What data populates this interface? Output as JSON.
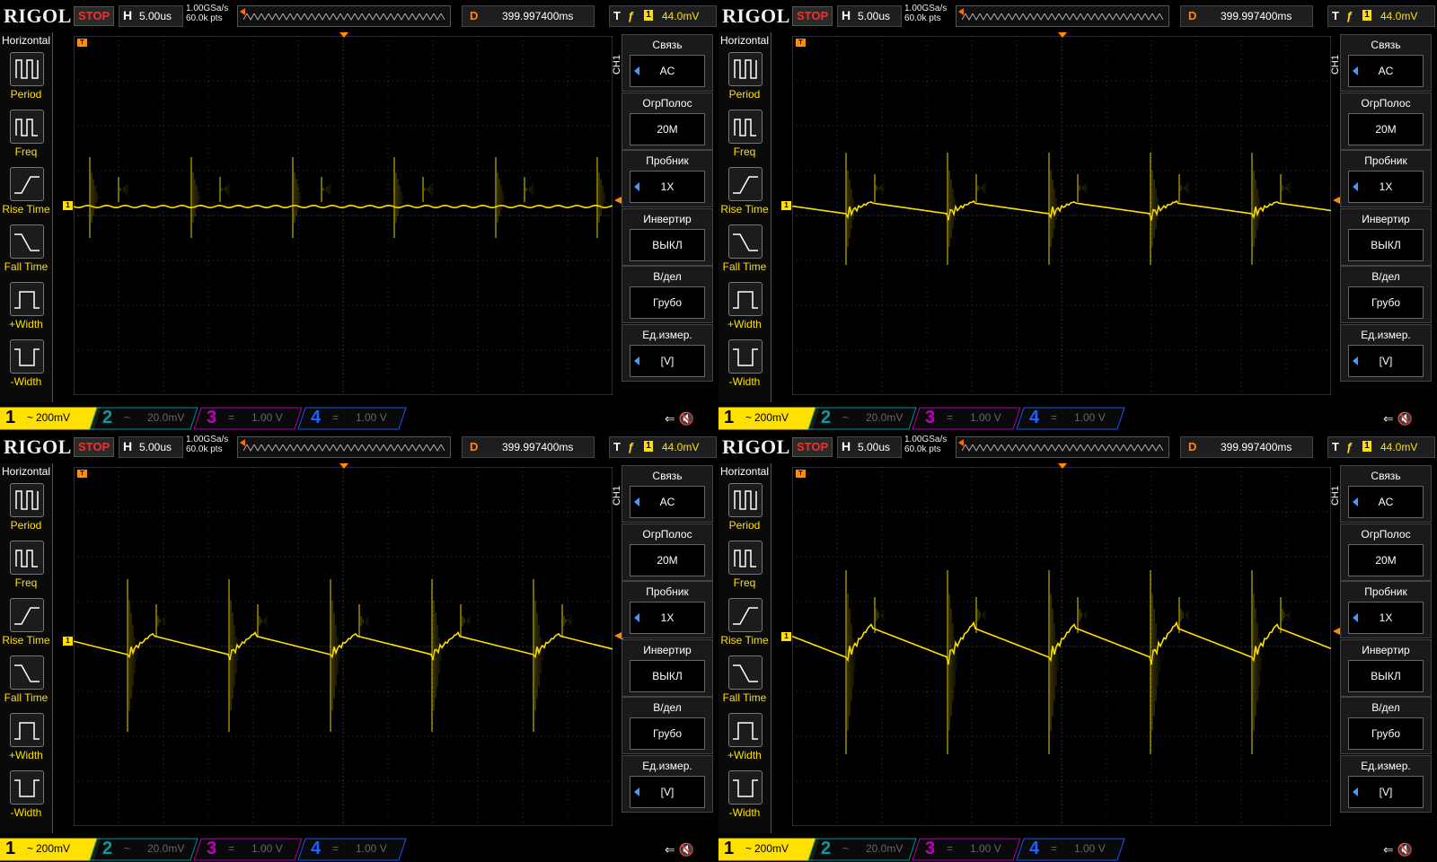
{
  "brand": "RIGOL",
  "run_state": "STOP",
  "horizontal": {
    "key": "H",
    "timebase": "5.00us"
  },
  "sample": {
    "rate": "1.00GSa/s",
    "depth": "60.0k pts"
  },
  "delay": {
    "key": "D",
    "value": "399.997400ms"
  },
  "trigger": {
    "key": "T",
    "edge": "ƒ",
    "source": "1",
    "level": "44.0mV"
  },
  "left_menu": {
    "title": "Horizontal",
    "items": [
      "Period",
      "Freq",
      "Rise Time",
      "Fall Time",
      "+Width",
      "-Width"
    ]
  },
  "right_menu": {
    "channel_label": "CH1",
    "items": [
      {
        "title": "Связь",
        "value": "AC",
        "arrow": true
      },
      {
        "title": "ОгрПолос",
        "value": "20M",
        "arrow": false
      },
      {
        "title": "Пробник",
        "value": "1X",
        "arrow": true
      },
      {
        "title": "Инвертир",
        "value": "ВЫКЛ",
        "arrow": false
      },
      {
        "title": "В/дел",
        "value": "Грубо",
        "arrow": false
      },
      {
        "title": "Ед.измер.",
        "value": "[V]",
        "arrow": true
      }
    ]
  },
  "channels": [
    {
      "num": "1",
      "coupling": "~",
      "scale": "200mV",
      "color": "#ffe000"
    },
    {
      "num": "2",
      "coupling": "~",
      "scale": "20.0mV",
      "color": "#00a0a0"
    },
    {
      "num": "3",
      "coupling": "=",
      "scale": "1.00 V",
      "color": "#c000c0"
    },
    {
      "num": "4",
      "coupling": "=",
      "scale": "1.00 V",
      "color": "#2060ff"
    }
  ],
  "screens": [
    {
      "pattern": "flat"
    },
    {
      "pattern": "saw_small"
    },
    {
      "pattern": "saw_medium"
    },
    {
      "pattern": "saw_large"
    }
  ]
}
